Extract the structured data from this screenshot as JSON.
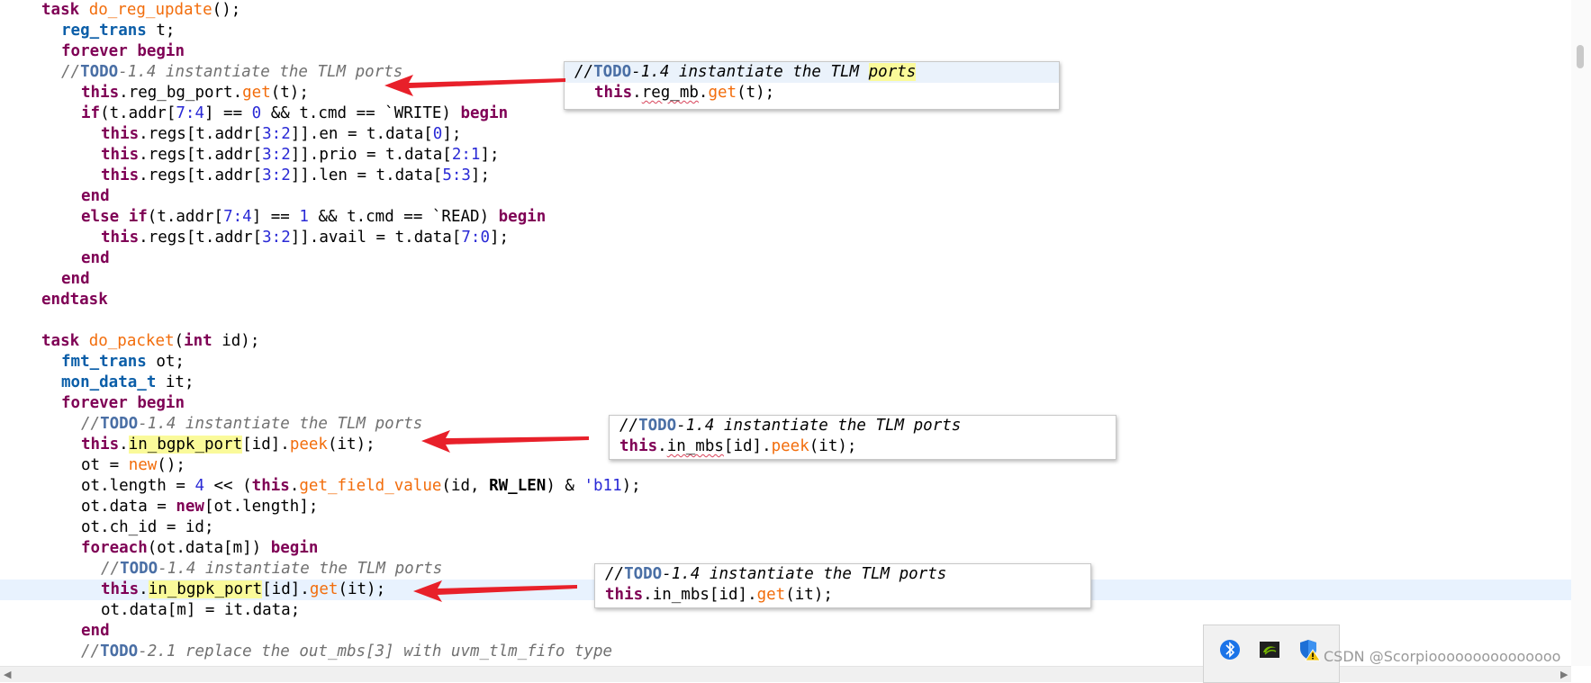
{
  "code": {
    "task1_decl": {
      "kw": "task",
      "name": "do_reg_update",
      "tail": "();"
    },
    "reg_trans_decl": {
      "type": "reg_trans",
      "tail": " t;"
    },
    "forever_begin": {
      "kw1": "forever",
      "kw2": "begin"
    },
    "todo_comment": {
      "prefix": "//",
      "todo": "TODO",
      "text": "-1.4 instantiate the TLM ports"
    },
    "reg_get": {
      "this": "this",
      "mid": ".reg_bg_port.",
      "fn": "get",
      "tail": "(t);"
    },
    "if_line": {
      "kw": "if",
      "p1": "(t.addr[",
      "n1": "7:4",
      "p2": "] == ",
      "n2": "0",
      "p3": " && t.cmd == `WRITE) ",
      "kw2": "begin"
    },
    "regs_en": {
      "this": "this",
      "p1": ".regs[t.addr[",
      "n1": "3:2",
      "p2": "]].en = t.data[",
      "n2": "0",
      "p3": "];"
    },
    "regs_prio": {
      "this": "this",
      "p1": ".regs[t.addr[",
      "n1": "3:2",
      "p2": "]].prio = t.data[",
      "n2": "2:1",
      "p3": "];"
    },
    "regs_len": {
      "this": "this",
      "p1": ".regs[t.addr[",
      "n1": "3:2",
      "p2": "]].len = t.data[",
      "n2": "5:3",
      "p3": "];"
    },
    "end_kw": "end",
    "else_if": {
      "kw1": "else",
      "kw2": "if",
      "p1": "(t.addr[",
      "n1": "7:4",
      "p2": "] == ",
      "n2": "1",
      "p3": " && t.cmd == `READ) ",
      "kw3": "begin"
    },
    "regs_avail": {
      "this": "this",
      "p1": ".regs[t.addr[",
      "n1": "3:2",
      "p2": "]].avail = t.data[",
      "n2": "7:0",
      "p3": "];"
    },
    "endtask_kw": "endtask",
    "task2_decl": {
      "kw": "task",
      "name": "do_packet",
      "p1": "(",
      "kw2": "int",
      "p2": " id);"
    },
    "fmt_trans_decl": {
      "type": "fmt_trans",
      "tail": " ot;"
    },
    "mon_data_decl": {
      "type": "mon_data_t",
      "tail": " it;"
    },
    "peek_line": {
      "this": "this",
      "dot": ".",
      "port": "in_bgpk_port",
      "mid": "[id].",
      "fn": "peek",
      "tail": "(it);"
    },
    "ot_new": {
      "p1": "ot = ",
      "fn": "new",
      "p2": "();"
    },
    "ot_length": {
      "p1": "ot.length = ",
      "n1": "4",
      "p2": " << (",
      "this": "this",
      "dot": ".",
      "fn": "get_field_value",
      "p3": "(id, ",
      "c": "RW_LEN",
      "p4": ") & ",
      "n2": "'b11",
      "p5": ");"
    },
    "ot_data": {
      "p1": "ot.data = ",
      "kw": "new",
      "p2": "[ot.length];"
    },
    "ot_chid": "ot.ch_id = id;",
    "foreach_line": {
      "kw": "foreach",
      "p1": "(ot.data[m]) ",
      "kw2": "begin"
    },
    "get_line": {
      "this": "this",
      "dot": ".",
      "port": "in_bgpk_port",
      "mid": "[id].",
      "fn": "get",
      "tail": "(it);"
    },
    "otdata_assign": "ot.data[m] = it.data;",
    "todo21": {
      "prefix": "//",
      "todo": "TODO",
      "text": "-2.1 replace the out_mbs[3] with uvm_tlm_fifo type"
    }
  },
  "popups": {
    "p1": {
      "comment": {
        "prefix": "//",
        "todo": "TODO",
        "mid": "-1.4 instantiate the TLM ",
        "hl": "ports"
      },
      "code": {
        "this": "this",
        "dot": ".",
        "port": "reg_mb",
        "dot2": ".",
        "fn": "get",
        "tail": "(t);"
      }
    },
    "p2": {
      "comment": {
        "prefix": "//",
        "todo": "TODO",
        "text": "-1.4 instantiate the TLM ports"
      },
      "code": {
        "this": "this",
        "dot": ".",
        "port": "in_mbs",
        "mid": "[id].",
        "fn": "peek",
        "tail": "(it);"
      }
    },
    "p3": {
      "comment": {
        "prefix": "//",
        "todo": "TODO",
        "text": "-1.4 instantiate the TLM ports"
      },
      "code": {
        "this": "this",
        "dot": ".",
        "port": "in_mbs",
        "mid": "[id].",
        "fn": "get",
        "tail": "(it);"
      }
    }
  },
  "tray": {
    "icons": [
      "bluetooth-icon",
      "nvidia-icon",
      "security-shield-icon"
    ]
  },
  "watermark": "CSDN @Scorpiooooooooooooooo",
  "colors": {
    "keyword": "#7f0055",
    "type": "#0b5ea8",
    "function": "#f26d0c",
    "number": "#2a2ad6",
    "comment": "#717171",
    "highlight": "#fafa9a",
    "arrow": "#e8202a"
  }
}
